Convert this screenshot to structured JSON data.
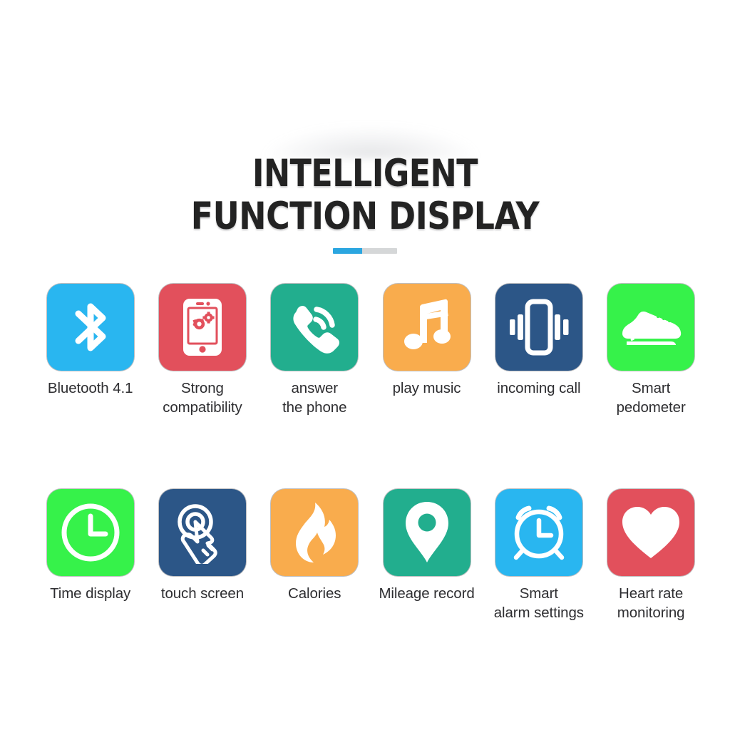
{
  "heading": {
    "line1": "INTELLIGENT",
    "line2": "FUNCTION DISPLAY"
  },
  "divider": {
    "accent_color": "#2BA6E0",
    "muted_color": "#D5D7D8",
    "accent_ratio": "45%"
  },
  "palette": {
    "sky_blue": "#29B6F0",
    "red": "#E2505C",
    "teal": "#22AE8E",
    "orange": "#F9AC4D",
    "navy": "#2C5687",
    "bright_green": "#36F24A",
    "icon_white": "#FFFFFF",
    "label_text": "#2E2E31",
    "background": "#FFFFFF"
  },
  "features": {
    "row1": [
      {
        "label": "Bluetooth 4.1",
        "icon": "bluetooth-icon",
        "tile_color": "#29B6F0"
      },
      {
        "label": "Strong\ncompatibility",
        "icon": "phone-gears-icon",
        "tile_color": "#E2505C"
      },
      {
        "label": "answer\nthe phone",
        "icon": "handset-signal-icon",
        "tile_color": "#22AE8E"
      },
      {
        "label": "play music",
        "icon": "music-note-icon",
        "tile_color": "#F9AC4D"
      },
      {
        "label": "incoming call",
        "icon": "vibrating-phone-icon",
        "tile_color": "#2C5687"
      },
      {
        "label": "Smart\npedometer",
        "icon": "running-shoe-icon",
        "tile_color": "#36F24A"
      }
    ],
    "row2": [
      {
        "label": "Time display",
        "icon": "clock-icon",
        "tile_color": "#36F24A"
      },
      {
        "label": "touch screen",
        "icon": "tap-hand-icon",
        "tile_color": "#2C5687"
      },
      {
        "label": "Calories",
        "icon": "flame-icon",
        "tile_color": "#F9AC4D"
      },
      {
        "label": "Mileage record",
        "icon": "map-pin-icon",
        "tile_color": "#22AE8E"
      },
      {
        "label": "Smart\nalarm settings",
        "icon": "alarm-clock-icon",
        "tile_color": "#29B6F0"
      },
      {
        "label": "Heart rate\nmonitoring",
        "icon": "heart-icon",
        "tile_color": "#E2505C"
      }
    ]
  }
}
